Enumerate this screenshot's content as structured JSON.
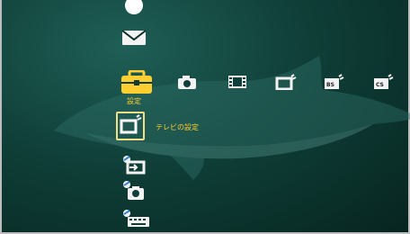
{
  "menu": {
    "selected_category_label": "設定",
    "selected_item_label": "テレビの設定",
    "accent_color": "#ffcf32",
    "selection_border_color": "#f2e089"
  },
  "top_row": [
    {
      "name": "photo",
      "icon": "camera-icon"
    },
    {
      "name": "video",
      "icon": "film-icon"
    },
    {
      "name": "tv",
      "icon": "tv-broadcast-icon"
    },
    {
      "name": "bs",
      "icon": "bs-icon",
      "text": "BS"
    },
    {
      "name": "cs",
      "icon": "cs-icon",
      "text": "CS"
    }
  ],
  "left_column": [
    {
      "name": "mail",
      "icon": "envelope-icon"
    },
    {
      "name": "settings",
      "icon": "toolbox-icon"
    },
    {
      "name": "tv-settings",
      "icon": "tv-settings-icon"
    },
    {
      "name": "input-settings",
      "icon": "input-settings-icon"
    },
    {
      "name": "photo-settings",
      "icon": "camera-settings-icon"
    },
    {
      "name": "keyboard-settings",
      "icon": "keyboard-settings-icon"
    }
  ]
}
